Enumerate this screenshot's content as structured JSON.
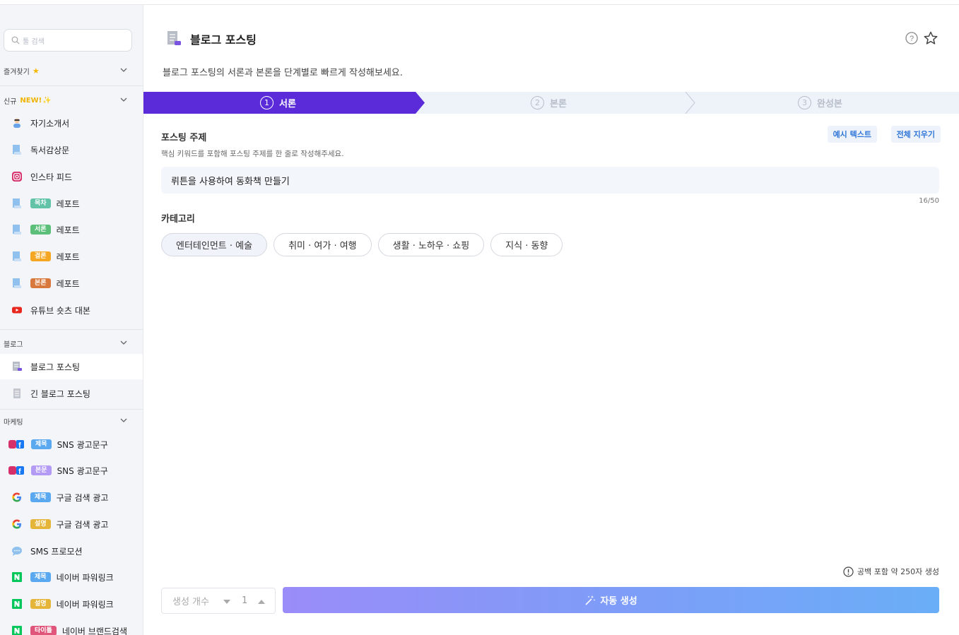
{
  "sidebar": {
    "search_placeholder": "툴 검색",
    "favorites_label": "즐겨찾기",
    "new_section": {
      "label": "신규",
      "badge": "NEW!"
    },
    "new_items": [
      {
        "label": "자기소개서"
      },
      {
        "label": "독서감상문"
      },
      {
        "label": "인스타 피드"
      },
      {
        "tag": "목차",
        "label": "레포트"
      },
      {
        "tag": "서론",
        "label": "레포트"
      },
      {
        "tag": "결론",
        "label": "레포트"
      },
      {
        "tag": "본론",
        "label": "레포트"
      },
      {
        "label": "유튜브 숏츠 대본"
      }
    ],
    "blog_section": "블로그",
    "blog_items": [
      {
        "label": "블로그 포스팅"
      },
      {
        "label": "긴 블로그 포스팅"
      }
    ],
    "marketing_section": "마케팅",
    "marketing_items": [
      {
        "tag": "제목",
        "label": "SNS 광고문구"
      },
      {
        "tag": "본문",
        "label": "SNS 광고문구"
      },
      {
        "tag": "제목",
        "label": "구글 검색 광고"
      },
      {
        "tag": "설명",
        "label": "구글 검색 광고"
      },
      {
        "label": "SMS 프로모션"
      },
      {
        "tag": "제목",
        "label": "네이버 파워링크"
      },
      {
        "tag": "설명",
        "label": "네이버 파워링크"
      },
      {
        "tag": "타이틀",
        "label": "네이버 브랜드검색"
      }
    ]
  },
  "main": {
    "title": "블로그 포스팅",
    "subtitle": "블로그 포스팅의 서론과 본론을 단계별로 빠르게 작성해보세요.",
    "steps": [
      {
        "num": "1",
        "label": "서론"
      },
      {
        "num": "2",
        "label": "본론"
      },
      {
        "num": "3",
        "label": "완성본"
      }
    ],
    "topic_label": "포스팅 주제",
    "topic_hint": "핵심 키워드를 포함해 포스팅 주제를 한 줄로 작성해주세요.",
    "example_button": "예시 텍스트",
    "clear_button": "전체 지우기",
    "topic_value": "뤼튼을 사용하여 동화책 만들기",
    "topic_counter": "16/50",
    "category_label": "카테고리",
    "categories": [
      "엔터테인먼트 · 예술",
      "취미 · 여가 · 여행",
      "생활 · 노하우 · 쇼핑",
      "지식 · 동향"
    ],
    "length_info": "공백 포함 약 250자 생성",
    "count_label": "생성 개수",
    "count_value": "1",
    "generate_button": "자동 생성"
  },
  "colors": {
    "accent": "#5b2bd9",
    "tag_green": "#62c3a8",
    "tag_orange": "#f5a623",
    "tag_brown": "#d9783c",
    "tag_blue": "#5aa8f0",
    "tag_purple": "#b39af5",
    "tag_yellow": "#e5b53a",
    "tag_pink": "#e0567a"
  }
}
